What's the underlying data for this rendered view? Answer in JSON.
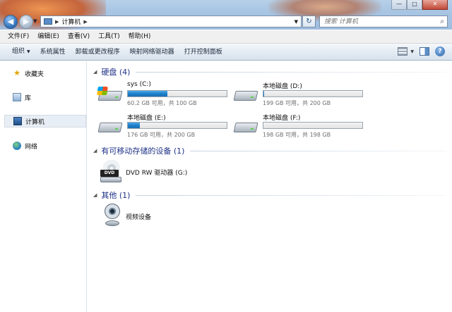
{
  "titlebar": {
    "breadcrumb": [
      "计算机"
    ],
    "search_placeholder": "搜索 计算机",
    "window_controls": {
      "minimize": "—",
      "maximize": "□",
      "close": "✕"
    }
  },
  "menubar": {
    "items": [
      "文件(F)",
      "编辑(E)",
      "查看(V)",
      "工具(T)",
      "帮助(H)"
    ]
  },
  "commandbar": {
    "items": [
      "组织",
      "系统属性",
      "卸载或更改程序",
      "映射网络驱动器",
      "打开控制面板"
    ]
  },
  "navpane": {
    "items": [
      {
        "label": "收藏夹",
        "icon": "star-icon"
      },
      {
        "label": "库",
        "icon": "library-icon"
      },
      {
        "label": "计算机",
        "icon": "computer-icon",
        "selected": true
      },
      {
        "label": "网络",
        "icon": "network-icon"
      }
    ]
  },
  "groups": {
    "hard_disks": "硬盘 (4)",
    "removable": "有可移动存储的设备 (1)",
    "other": "其他 (1)"
  },
  "drives": [
    {
      "name": "sys (C:)",
      "free": "60.2 GB 可用，共 100 GB",
      "used_fraction": 0.398
    },
    {
      "name": "本地磁盘 (D:)",
      "free": "199 GB 可用，共 200 GB",
      "used_fraction": 0.005
    },
    {
      "name": "本地磁盘 (E:)",
      "free": "176 GB 可用，共 200 GB",
      "used_fraction": 0.12
    },
    {
      "name": "本地磁盘 (F:)",
      "free": "198 GB 可用，共 198 GB",
      "used_fraction": 0.0
    }
  ],
  "removable_devices": [
    {
      "name": "DVD RW 驱动器 (G:)",
      "icon_label": "DVD"
    }
  ],
  "other_devices": [
    {
      "name": "视频设备"
    }
  ],
  "colors": {
    "group_header": "#1e3287",
    "drive_fill": "#1e7fc9"
  }
}
